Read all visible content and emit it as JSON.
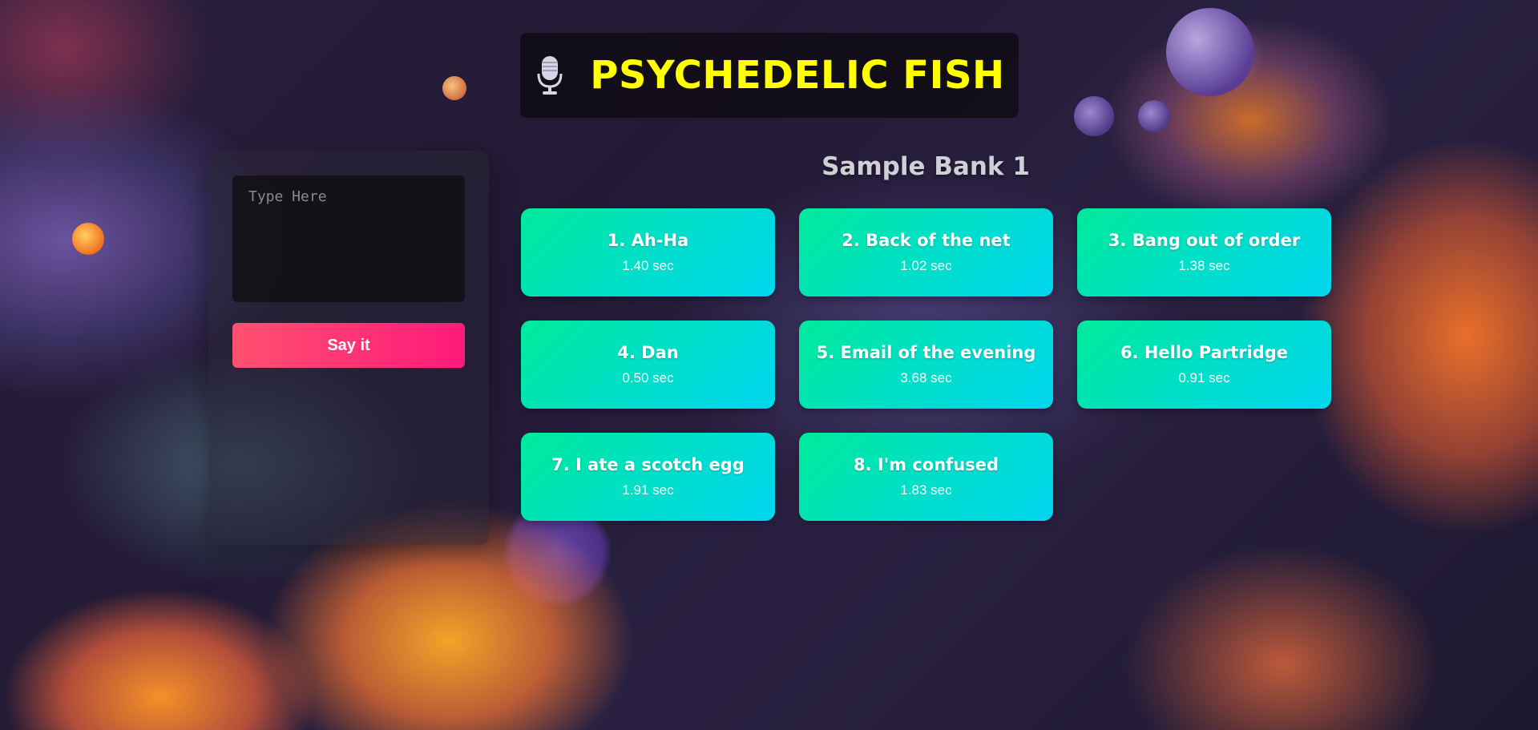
{
  "header": {
    "title": "PSYCHEDELIC FISH",
    "icon": "microphone-icon"
  },
  "speech": {
    "placeholder": "Type Here",
    "value": "",
    "button_label": "Say it"
  },
  "bank": {
    "title": "Sample Bank 1",
    "samples": [
      {
        "label": "1. Ah-Ha",
        "duration": "1.40 sec"
      },
      {
        "label": "2. Back of the net",
        "duration": "1.02 sec"
      },
      {
        "label": "3. Bang out of order",
        "duration": "1.38 sec"
      },
      {
        "label": "4. Dan",
        "duration": "0.50 sec"
      },
      {
        "label": "5. Email of the evening",
        "duration": "3.68 sec"
      },
      {
        "label": "6. Hello Partridge",
        "duration": "0.91 sec"
      },
      {
        "label": "7. I ate a scotch egg",
        "duration": "1.91 sec"
      },
      {
        "label": "8. I'm confused",
        "duration": "1.83 sec"
      }
    ]
  },
  "colors": {
    "title": "#ffff00",
    "button_gradient_start": "#00ea9a",
    "button_gradient_end": "#00d5ef",
    "say_button_start": "#ff5070",
    "say_button_end": "#ff1a7a"
  }
}
